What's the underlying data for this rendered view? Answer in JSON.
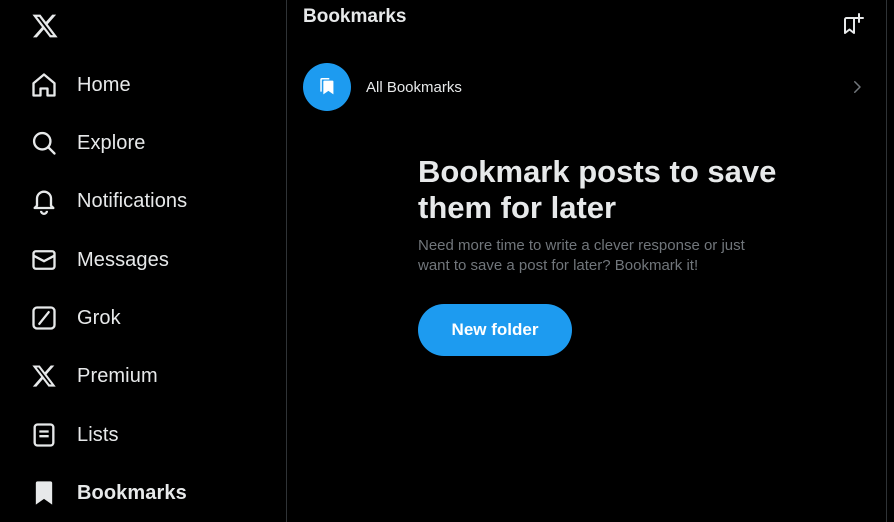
{
  "brand": {
    "logo_icon": "x-logo-icon"
  },
  "sidebar": {
    "items": [
      {
        "label": "Home",
        "icon": "home-icon"
      },
      {
        "label": "Explore",
        "icon": "search-icon"
      },
      {
        "label": "Notifications",
        "icon": "bell-icon"
      },
      {
        "label": "Messages",
        "icon": "envelope-icon"
      },
      {
        "label": "Grok",
        "icon": "grok-icon"
      },
      {
        "label": "Premium",
        "icon": "x-logo-icon"
      },
      {
        "label": "Lists",
        "icon": "list-icon"
      },
      {
        "label": "Bookmarks",
        "icon": "bookmark-icon",
        "active": true
      }
    ]
  },
  "header": {
    "title": "Bookmarks",
    "action_icon": "new-folder-icon"
  },
  "folders": [
    {
      "label": "All Bookmarks",
      "icon": "bookmarks-icon"
    }
  ],
  "empty_state": {
    "title": "Bookmark posts to save them for later",
    "subtitle": "Need more time to write a clever response or just want to save a post for later? Bookmark it!",
    "button_label": "New folder"
  },
  "colors": {
    "background": "#000000",
    "accent": "#1d9bf0",
    "text_primary": "#e7e9ea",
    "text_secondary": "#71767b",
    "border": "#2f3336"
  }
}
